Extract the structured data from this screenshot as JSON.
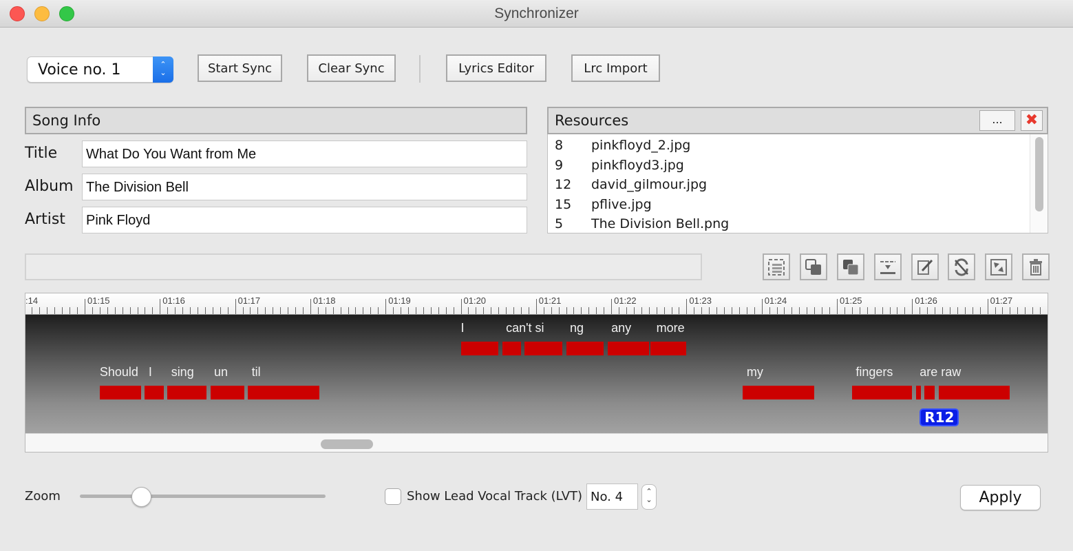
{
  "window": {
    "title": "Synchronizer"
  },
  "toolbar": {
    "voice_select": {
      "value": "Voice no. 1"
    },
    "start_sync": "Start Sync",
    "clear_sync": "Clear Sync",
    "lyrics_editor": "Lyrics Editor",
    "lrc_import": "Lrc Import"
  },
  "song_info": {
    "header": "Song Info",
    "fields": [
      {
        "label": "Title",
        "value": "What Do You Want from Me"
      },
      {
        "label": "Album",
        "value": "The Division Bell"
      },
      {
        "label": "Artist",
        "value": "Pink Floyd"
      }
    ]
  },
  "resources": {
    "header": "Resources",
    "more_button": "...",
    "delete_icon": "close-x-icon",
    "items": [
      {
        "num": "8",
        "name": "pinkfloyd_2.jpg"
      },
      {
        "num": "9",
        "name": "pinkfloyd3.jpg"
      },
      {
        "num": "12",
        "name": "david_gilmour.jpg"
      },
      {
        "num": "15",
        "name": "pflive.jpg"
      },
      {
        "num": "5",
        "name": "The Division Bell.png"
      }
    ]
  },
  "edit_tools": [
    {
      "icon": "select-region-icon"
    },
    {
      "icon": "copy-icon"
    },
    {
      "icon": "duplicate-icon"
    },
    {
      "icon": "insert-line-icon"
    },
    {
      "icon": "edit-icon"
    },
    {
      "icon": "unsync-icon"
    },
    {
      "icon": "resize-icon"
    },
    {
      "icon": "trash-icon"
    }
  ],
  "timeline": {
    "ruler_labels": [
      ":14",
      "01:15",
      "01:16",
      "01:17",
      "01:18",
      "01:19",
      "01:20",
      "01:21",
      "01:22",
      "01:23",
      "01:24",
      "01:25",
      "01:26",
      "01:27"
    ],
    "start_seconds": 74.0,
    "seconds_visible": 13.6,
    "upper_lane": [
      {
        "text": "I",
        "start": 80.0,
        "end": 80.5
      },
      {
        "text": "can't si",
        "start": 80.55,
        "end": 80.8
      },
      {
        "text": "ng",
        "start": 80.85,
        "end": 81.35
      },
      {
        "text": "any",
        "start": 81.4,
        "end": 81.9
      },
      {
        "text": "more",
        "start": 81.95,
        "end": 82.5
      },
      {
        "text": "",
        "start": 82.52,
        "end": 83.0
      }
    ],
    "upper_lane_labels": [
      {
        "text": "I",
        "at": 80.0
      },
      {
        "text": "can't si",
        "at": 80.6
      },
      {
        "text": "ng",
        "at": 81.45
      },
      {
        "text": "any",
        "at": 82.0
      },
      {
        "text": "more",
        "at": 82.6
      }
    ],
    "lower_lane": [
      {
        "text": "Should",
        "start": 75.2,
        "end": 75.75
      },
      {
        "text": "I",
        "start": 75.8,
        "end": 76.05
      },
      {
        "text": "sing",
        "start": 76.1,
        "end": 76.62
      },
      {
        "text": "un",
        "start": 76.67,
        "end": 77.12
      },
      {
        "text": "til",
        "start": 77.17,
        "end": 78.12
      },
      {
        "text": "my",
        "start": 83.75,
        "end": 84.7
      },
      {
        "text": "fingers",
        "start": 85.2,
        "end": 86.0
      },
      {
        "text": "are",
        "start": 86.05,
        "end": 86.12
      },
      {
        "text": "",
        "start": 86.16,
        "end": 86.3
      },
      {
        "text": "raw",
        "start": 86.35,
        "end": 87.3
      }
    ],
    "lower_lane_labels": [
      {
        "text": "Should",
        "at": 75.2
      },
      {
        "text": "I",
        "at": 75.85
      },
      {
        "text": "sing",
        "at": 76.15
      },
      {
        "text": "un",
        "at": 76.72
      },
      {
        "text": "til",
        "at": 77.22
      },
      {
        "text": "my",
        "at": 83.8
      },
      {
        "text": "fingers",
        "at": 85.25
      },
      {
        "text": "are raw",
        "at": 86.1
      }
    ],
    "marker": {
      "label": "R12",
      "at": 86.1
    },
    "bar_color": "#cc0000",
    "marker_color": "#0a1ee6"
  },
  "bottom": {
    "zoom_label": "Zoom",
    "zoom_value": 0.25,
    "lvt_checkbox_label": "Show Lead Vocal Track (LVT)",
    "lvt_checked": false,
    "lvt_number": "No. 4",
    "apply": "Apply"
  }
}
